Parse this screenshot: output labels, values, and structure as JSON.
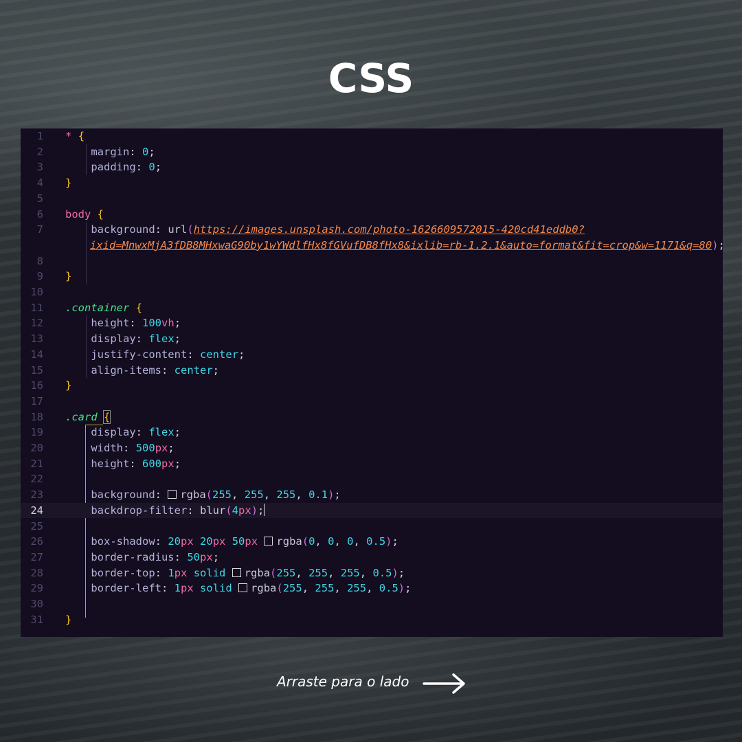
{
  "title": "CSS",
  "footer": {
    "label": "Arraste para o lado",
    "arrow_icon": "arrow-right-icon"
  },
  "editor": {
    "active_line": 24,
    "colors": {
      "background": "#130d1f",
      "selector_universal": "#f06ba8",
      "selector_class": "#44e389",
      "property": "#b4b2d8",
      "number": "#3fd7e5",
      "unit": "#f06ba8",
      "brace": "#f8c024",
      "url": "#f5884a"
    },
    "lines": [
      {
        "n": "1",
        "text": "* {"
      },
      {
        "n": "2",
        "text": "    margin: 0;"
      },
      {
        "n": "3",
        "text": "    padding: 0;"
      },
      {
        "n": "4",
        "text": "}"
      },
      {
        "n": "5",
        "text": ""
      },
      {
        "n": "6",
        "text": "body {"
      },
      {
        "n": "7",
        "text": "    background: url(https://images.unsplash.com/photo-1626609572015-420cd41eddb0?"
      },
      {
        "n": "",
        "text": "ixid=MnwxMjA3fDB8MHxwaG90by1wYWdlfHx8fGVufDB8fHx8&ixlib=rb-1.2.1&auto=format&fit=crop&w=1171&q=80);"
      },
      {
        "n": "8",
        "text": ""
      },
      {
        "n": "9",
        "text": "}"
      },
      {
        "n": "10",
        "text": ""
      },
      {
        "n": "11",
        "text": ".container {"
      },
      {
        "n": "12",
        "text": "    height: 100vh;"
      },
      {
        "n": "13",
        "text": "    display: flex;"
      },
      {
        "n": "14",
        "text": "    justify-content: center;"
      },
      {
        "n": "15",
        "text": "    align-items: center;"
      },
      {
        "n": "16",
        "text": "}"
      },
      {
        "n": "17",
        "text": ""
      },
      {
        "n": "18",
        "text": ".card {"
      },
      {
        "n": "19",
        "text": "    display: flex;"
      },
      {
        "n": "20",
        "text": "    width: 500px;"
      },
      {
        "n": "21",
        "text": "    height: 600px;"
      },
      {
        "n": "22",
        "text": ""
      },
      {
        "n": "23",
        "text": "    background: rgba(255, 255, 255, 0.1);"
      },
      {
        "n": "24",
        "text": "    backdrop-filter: blur(4px);"
      },
      {
        "n": "25",
        "text": ""
      },
      {
        "n": "26",
        "text": "    box-shadow: 20px 20px 50px rgba(0, 0, 0, 0.5);"
      },
      {
        "n": "27",
        "text": "    border-radius: 50px;"
      },
      {
        "n": "28",
        "text": "    border-top: 1px solid rgba(255, 255, 255, 0.5);"
      },
      {
        "n": "29",
        "text": "    border-left: 1px solid rgba(255, 255, 255, 0.5);"
      },
      {
        "n": "30",
        "text": ""
      },
      {
        "n": "31",
        "text": "}"
      }
    ]
  }
}
